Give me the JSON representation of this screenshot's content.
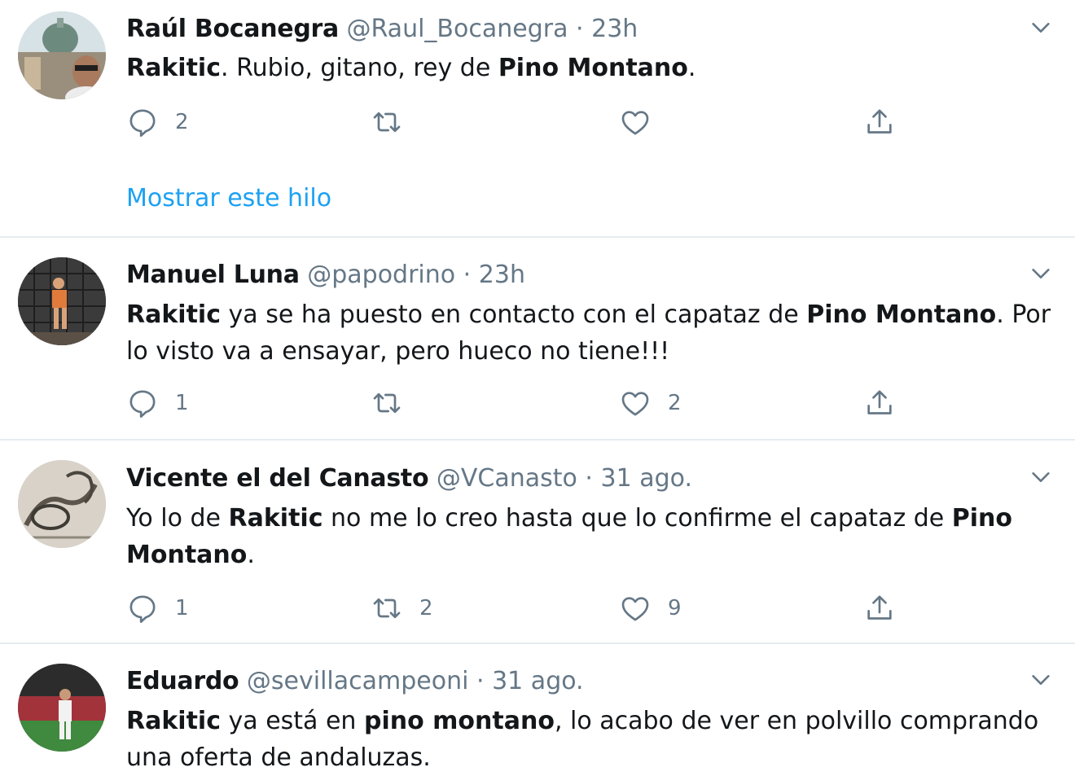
{
  "tweets": [
    {
      "name": "Raúl Bocanegra",
      "handle": "@Raul_Bocanegra",
      "separator": "·",
      "time": "23h",
      "text": [
        {
          "b": true,
          "t": "Rakitic"
        },
        {
          "b": false,
          "t": ". Rubio, gitano, rey de "
        },
        {
          "b": true,
          "t": "Pino Montano"
        },
        {
          "b": false,
          "t": "."
        }
      ],
      "reply_count": "2",
      "retweet_count": "",
      "like_count": "",
      "thread_link": "Mostrar este hilo"
    },
    {
      "name": "Manuel Luna",
      "handle": "@papodrino",
      "separator": "·",
      "time": "23h",
      "text": [
        {
          "b": true,
          "t": "Rakitic"
        },
        {
          "b": false,
          "t": " ya se ha puesto en contacto con el capataz de "
        },
        {
          "b": true,
          "t": "Pino Montano"
        },
        {
          "b": false,
          "t": ". Por lo visto va a ensayar, pero hueco no tiene!!!"
        }
      ],
      "reply_count": "1",
      "retweet_count": "",
      "like_count": "2"
    },
    {
      "name": "Vicente el del Canasto",
      "handle": "@VCanasto",
      "separator": "·",
      "time": "31 ago.",
      "text": [
        {
          "b": false,
          "t": "Yo lo de "
        },
        {
          "b": true,
          "t": "Rakitic"
        },
        {
          "b": false,
          "t": " no me lo creo hasta que lo confirme el capataz de "
        },
        {
          "b": true,
          "t": "Pino Montano"
        },
        {
          "b": false,
          "t": "."
        }
      ],
      "reply_count": "1",
      "retweet_count": "2",
      "like_count": "9"
    },
    {
      "name": "Eduardo",
      "handle": "@sevillacampeoni",
      "separator": "·",
      "time": "31 ago.",
      "text": [
        {
          "b": true,
          "t": "Rakitic"
        },
        {
          "b": false,
          "t": " ya está en "
        },
        {
          "b": true,
          "t": "pino montano"
        },
        {
          "b": false,
          "t": ", lo acabo de ver en polvillo comprando una oferta de andaluzas."
        }
      ]
    }
  ],
  "icons": {
    "reply": "reply-icon",
    "retweet": "retweet-icon",
    "like": "heart-icon",
    "share": "share-icon",
    "menu": "chevron-down-icon"
  },
  "colors": {
    "link": "#1da1f2",
    "secondary_text": "#657786",
    "divider": "#e6ecf0"
  }
}
